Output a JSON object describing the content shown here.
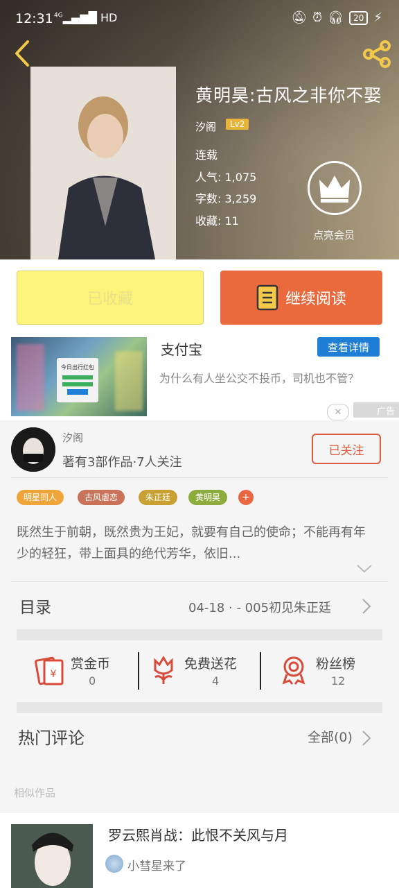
{
  "status_bar": {
    "time": "12:31",
    "network": "4G",
    "hd": "HD",
    "battery": "20"
  },
  "book": {
    "title": "黄明昊:古风之非你不娶",
    "author": "汐阁",
    "level": "Lv2",
    "status": "连载",
    "popularity_label": "人气:",
    "popularity": "1,075",
    "words_label": "字数:",
    "words": "3,259",
    "favorites_label": "收藏:",
    "favorites": "11"
  },
  "vip": {
    "label": "点亮会员"
  },
  "actions": {
    "favorite_label": "已收藏",
    "read_label": "继续阅读"
  },
  "ad": {
    "title": "支付宝",
    "button": "查看详情",
    "description": "为什么有人坐公交不投币，司机也不管？",
    "card_text": "今日出行红包",
    "close": "✕",
    "label": "广告"
  },
  "author_info": {
    "name": "汐阁",
    "stats": "著有3部作品·7人关注",
    "follow_label": "已关注"
  },
  "tags": [
    {
      "label": "明星同人",
      "color": "#f0a53a"
    },
    {
      "label": "古风虐恋",
      "color": "#c8735a"
    },
    {
      "label": "朱正廷",
      "color": "#c9a032"
    },
    {
      "label": "黄明昊",
      "color": "#8cad3e"
    }
  ],
  "tags_more": "+",
  "description": "既然生于前朝，既然贵为王妃，就要有自己的使命；不能再有年少的轻狂，带上面具的绝代芳华，依旧...",
  "toc": {
    "label": "目录",
    "latest": "04-18 · - 005初见朱正廷"
  },
  "stats": [
    {
      "label": "赏金币",
      "value": "0",
      "icon": "red-envelope-icon"
    },
    {
      "label": "免费送花",
      "value": "4",
      "icon": "flower-icon"
    },
    {
      "label": "粉丝榜",
      "value": "12",
      "icon": "medal-icon"
    }
  ],
  "comments": {
    "label": "热门评论",
    "all": "全部(0)"
  },
  "similar": {
    "label": "相似作品",
    "items": [
      {
        "title": "罗云熙肖战：此恨不关风与月",
        "author": "小彗星来了"
      }
    ]
  },
  "colors": {
    "accent": "#ea6a3d",
    "favorite": "#fbf37a",
    "ad_button": "#1f7fd6"
  }
}
